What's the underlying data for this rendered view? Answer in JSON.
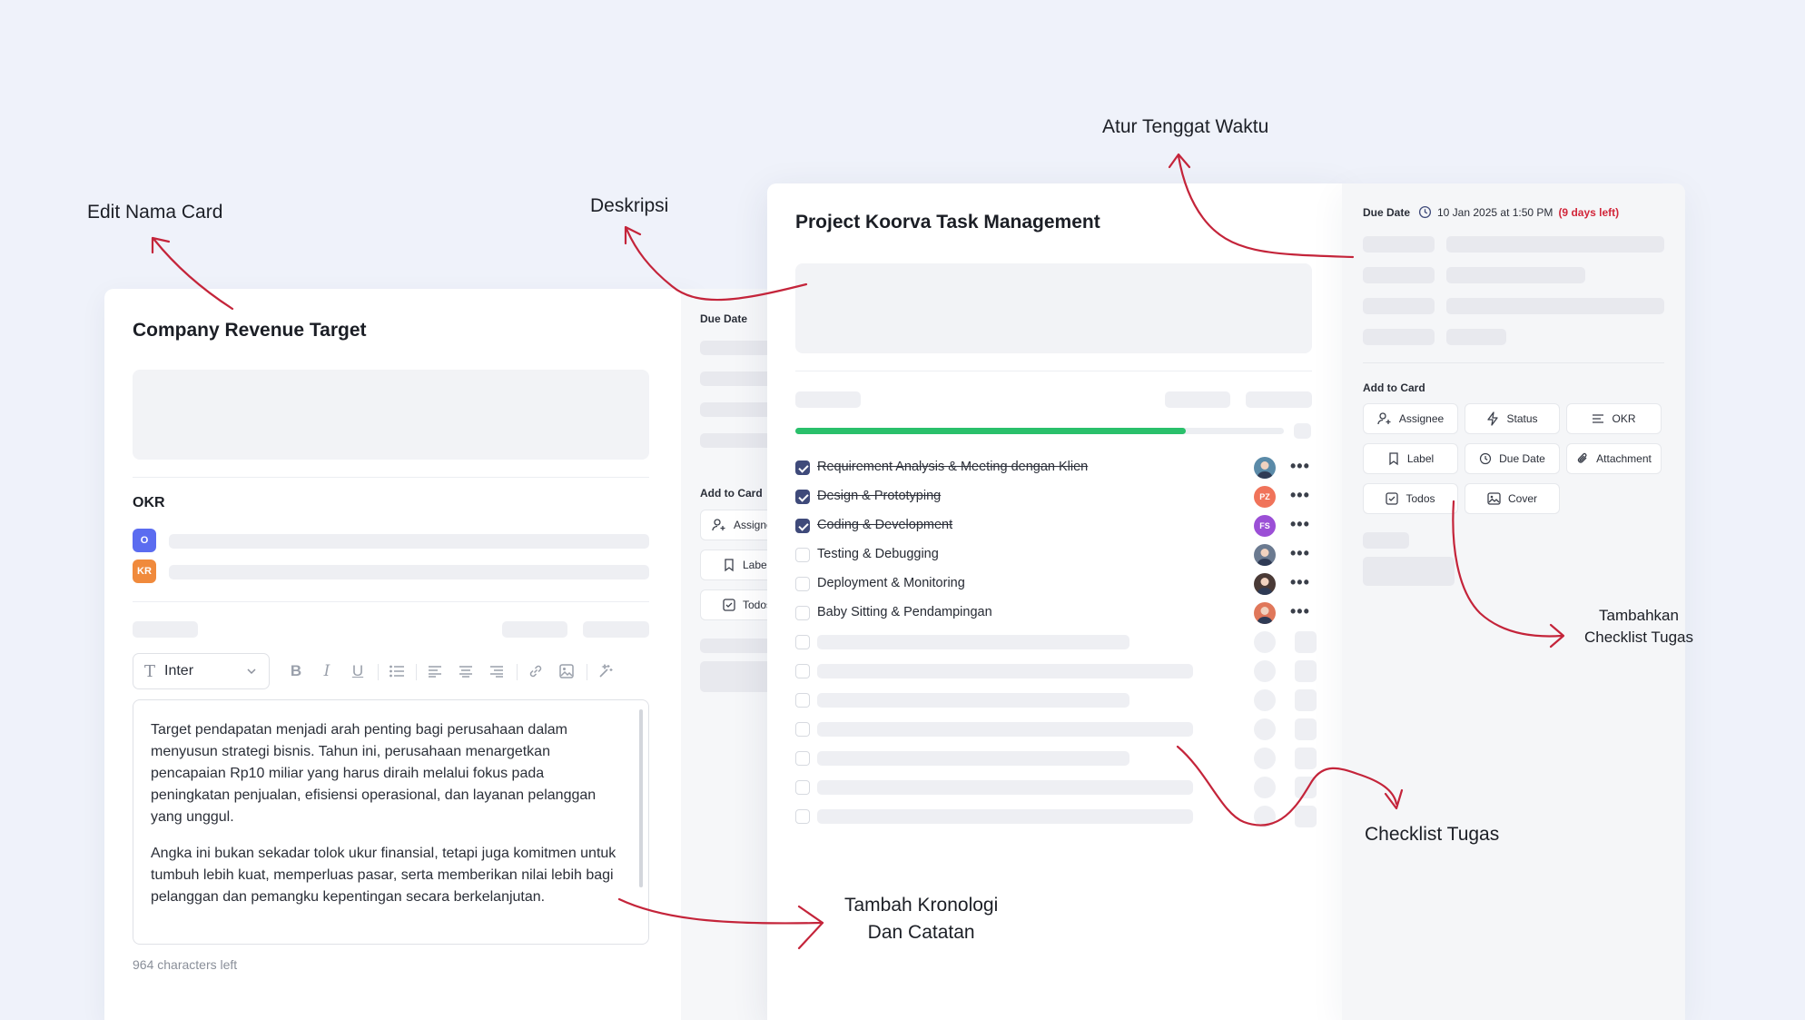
{
  "annotations": {
    "edit_card_name": "Edit Nama Card",
    "description": "Deskripsi",
    "set_deadline": "Atur Tenggat Waktu",
    "add_checklist_line1": "Tambahkan",
    "add_checklist_line2": "Checklist Tugas",
    "task_checklist": "Checklist Tugas",
    "timeline_line1": "Tambah Kronologi",
    "timeline_line2": "Dan Catatan"
  },
  "card1": {
    "title": "Company Revenue Target",
    "okr_label": "OKR",
    "okr_badges": [
      "O",
      "KR"
    ],
    "font_select": "Inter",
    "editor_paragraphs": [
      "Target pendapatan menjadi arah penting bagi perusahaan dalam menyusun strategi bisnis. Tahun ini, perusahaan menargetkan pencapaian Rp10 miliar yang harus diraih melalui fokus pada peningkatan penjualan, efisiensi operasional, dan layanan pelanggan yang unggul.",
      "Angka ini bukan sekadar tolok ukur finansial, tetapi juga komitmen untuk tumbuh lebih kuat, memperluas pasar, serta memberikan nilai lebih bagi pelanggan dan pemangku kepentingan secara berkelanjutan."
    ],
    "chars_left": "964 characters left",
    "side": {
      "due_date_label": "Due Date",
      "add_to_card_label": "Add to Card",
      "buttons": [
        "Assignee",
        "Label",
        "Todos"
      ]
    }
  },
  "card2": {
    "title": "Project Koorva Task Management",
    "progress": 0.8,
    "tasks": [
      {
        "label": "Requirement Analysis & Meeting dengan Klien",
        "done": true,
        "avatar": "",
        "avatar_color": "#5a8aa8"
      },
      {
        "label": "Design & Prototyping",
        "done": true,
        "avatar": "PZ",
        "avatar_color": "#f0735a"
      },
      {
        "label": "Coding & Development",
        "done": true,
        "avatar": "FS",
        "avatar_color": "#9b4fd6"
      },
      {
        "label": "Testing & Debugging",
        "done": false,
        "avatar": "",
        "avatar_color": "#6b7a90"
      },
      {
        "label": "Deployment & Monitoring",
        "done": false,
        "avatar": "",
        "avatar_color": "#4a3a36"
      },
      {
        "label": "Baby Sitting & Pendampingan",
        "done": false,
        "avatar": "",
        "avatar_color": "#e0775a"
      }
    ],
    "side": {
      "due_date_label": "Due Date",
      "due_date_value": "10 Jan 2025 at 1:50 PM",
      "days_left": "(9 days left)",
      "add_to_card_label": "Add to Card",
      "buttons": [
        "Assignee",
        "Status",
        "OKR",
        "Label",
        "Due Date",
        "Attachment",
        "Todos",
        "Cover"
      ]
    }
  },
  "colors": {
    "background": "#eff2fa",
    "arrow": "#c4243a",
    "progress": "#2ac06b",
    "checked": "#3f4a7a",
    "okr_badge": "#5b6cf0",
    "kr_badge": "#f08a3c",
    "days_left": "#d2263a"
  }
}
